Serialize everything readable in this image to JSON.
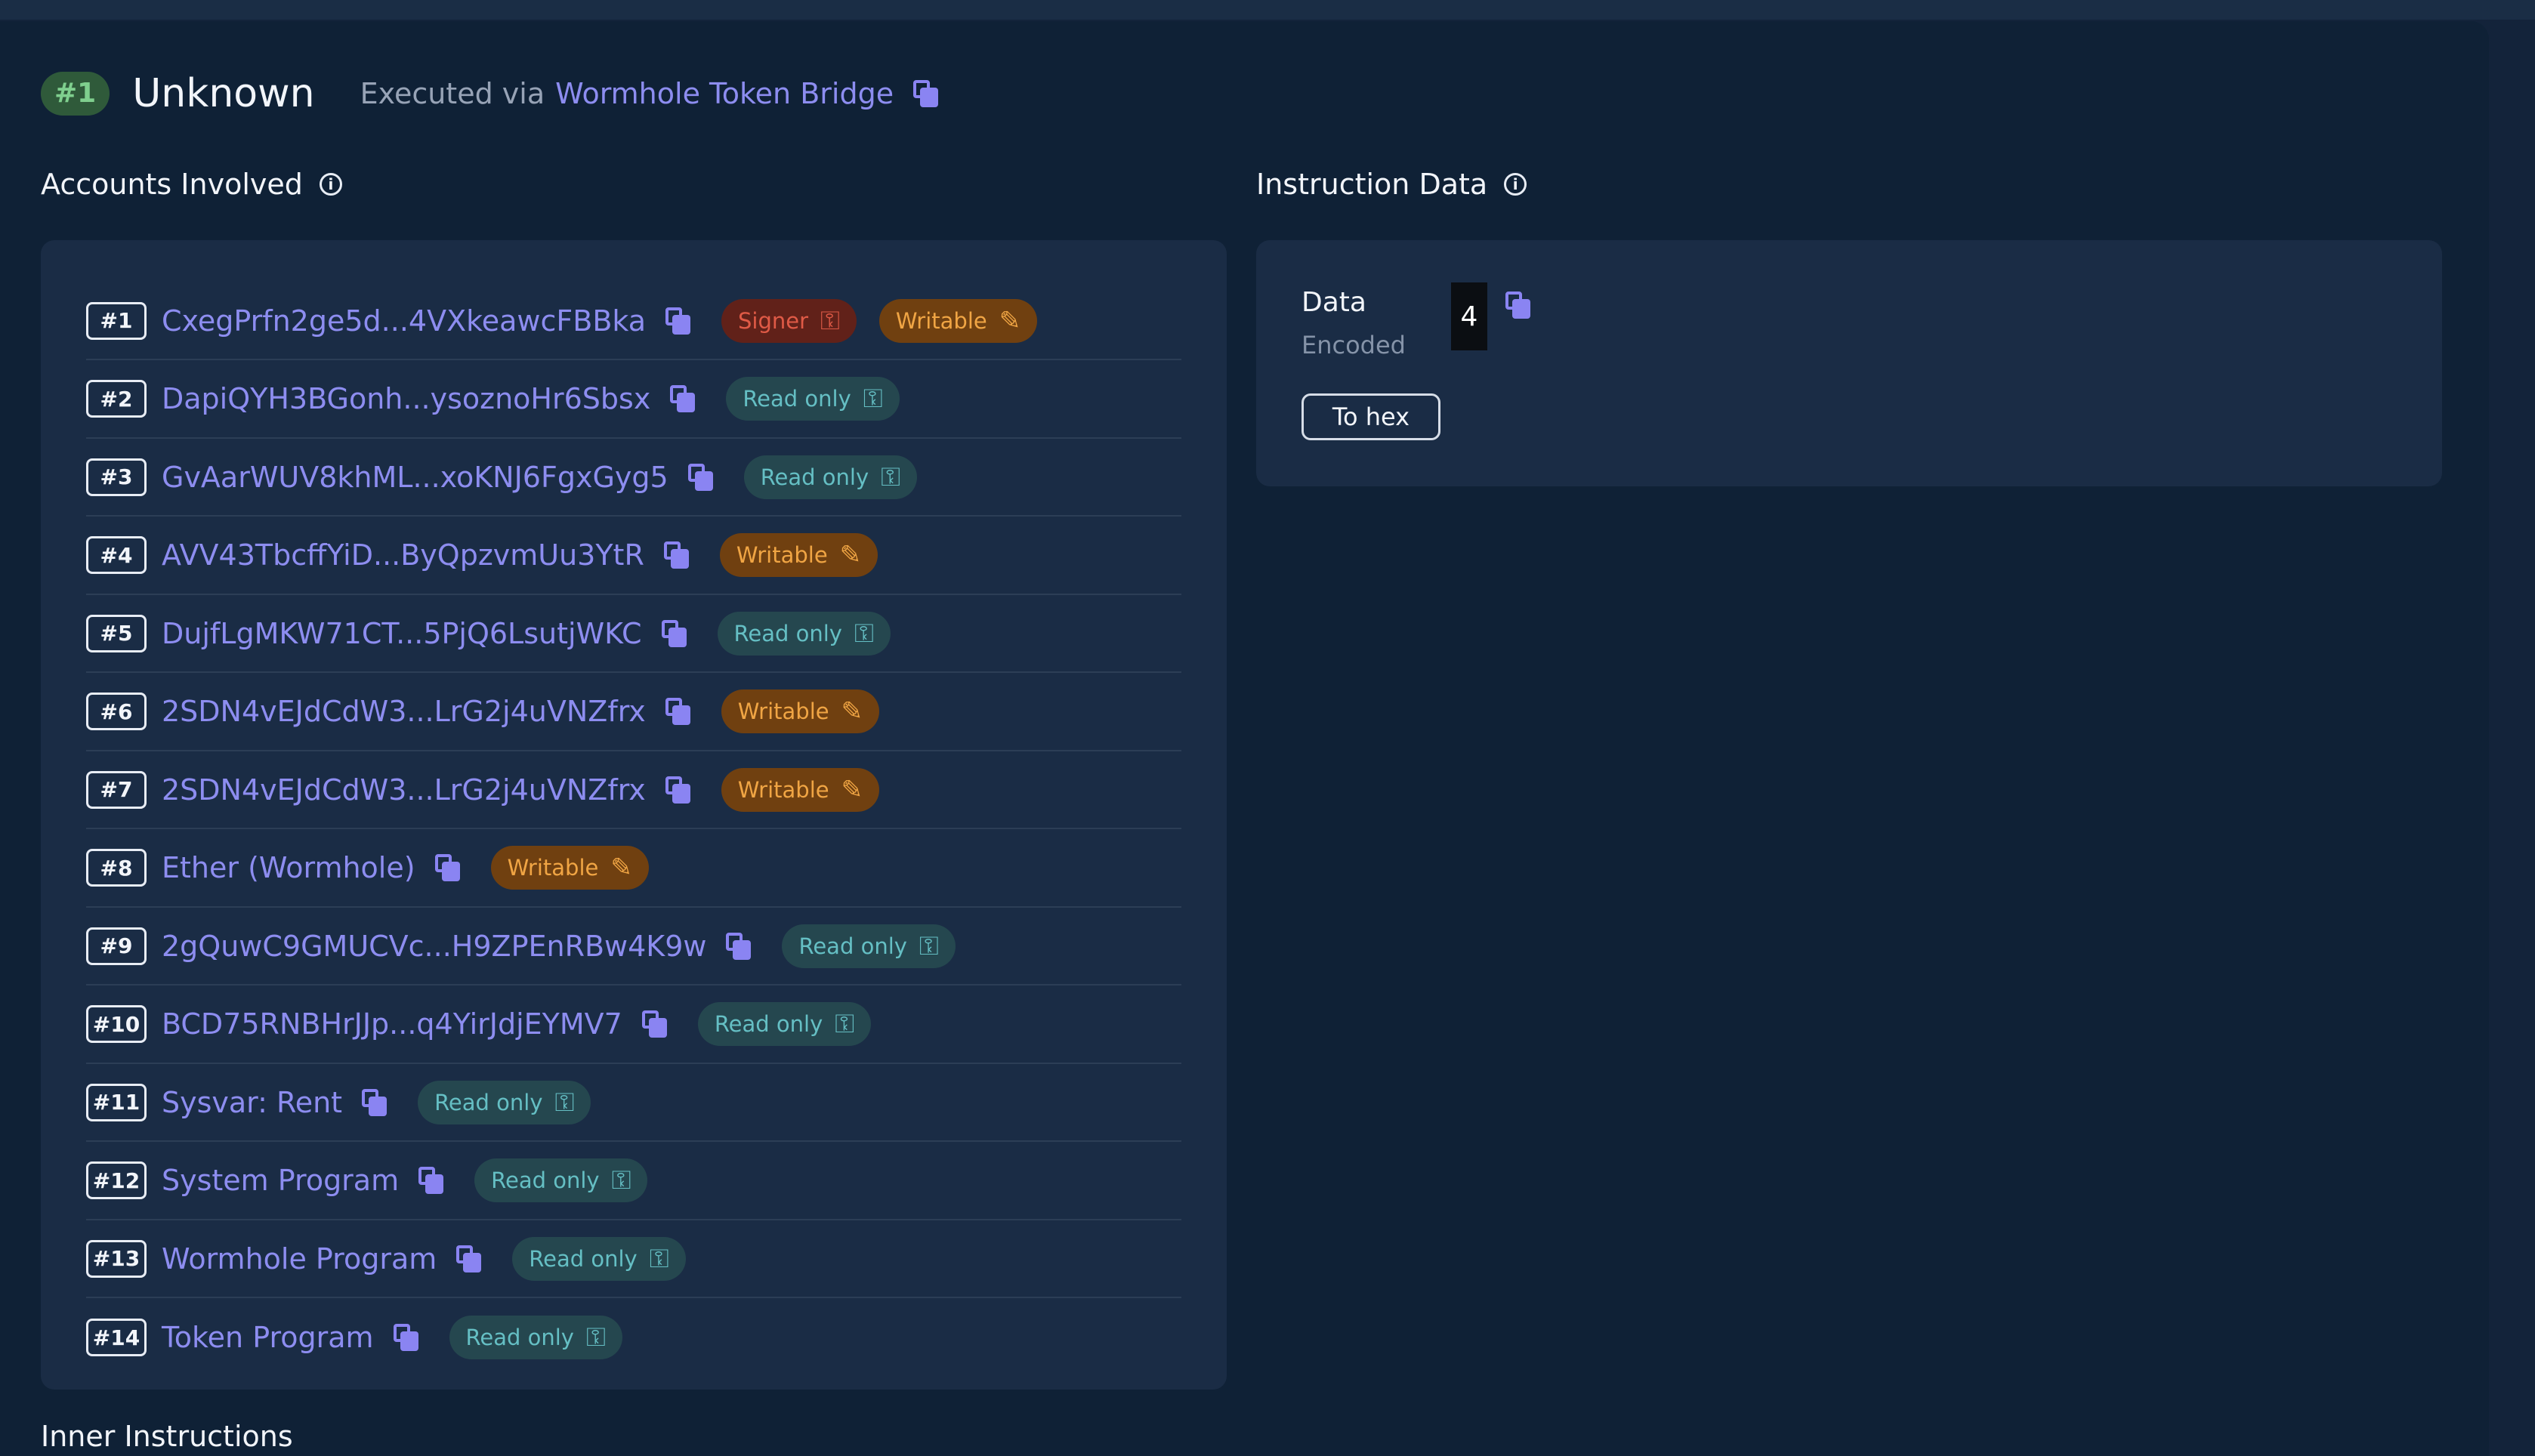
{
  "instruction": {
    "index": "#1",
    "title": "Unknown",
    "executed_via_label": "Executed via",
    "program_link": "Wormhole Token Bridge"
  },
  "accounts": {
    "title": "Accounts Involved",
    "rows": [
      {
        "index": "#1",
        "address": "CxegPrfn2ge5d...4VXkeawcFBBka",
        "badges": [
          {
            "kind": "sg",
            "label": "Signer",
            "icon": "key-icon"
          },
          {
            "kind": "wr",
            "label": "Writable",
            "icon": "pencil-icon"
          }
        ]
      },
      {
        "index": "#2",
        "address": "DapiQYH3BGonh...ysoznoHr6Sbsx",
        "badges": [
          {
            "kind": "ro",
            "label": "Read only",
            "icon": "key-icon"
          }
        ]
      },
      {
        "index": "#3",
        "address": "GvAarWUV8khML...xoKNJ6FgxGyg5",
        "badges": [
          {
            "kind": "ro",
            "label": "Read only",
            "icon": "key-icon"
          }
        ]
      },
      {
        "index": "#4",
        "address": "AVV43TbcffYiD...ByQpzvmUu3YtR",
        "badges": [
          {
            "kind": "wr",
            "label": "Writable",
            "icon": "pencil-icon"
          }
        ]
      },
      {
        "index": "#5",
        "address": "DujfLgMKW71CT...5PjQ6LsutjWKC",
        "badges": [
          {
            "kind": "ro",
            "label": "Read only",
            "icon": "key-icon"
          }
        ]
      },
      {
        "index": "#6",
        "address": "2SDN4vEJdCdW3...LrG2j4uVNZfrx",
        "badges": [
          {
            "kind": "wr",
            "label": "Writable",
            "icon": "pencil-icon"
          }
        ]
      },
      {
        "index": "#7",
        "address": "2SDN4vEJdCdW3...LrG2j4uVNZfrx",
        "badges": [
          {
            "kind": "wr",
            "label": "Writable",
            "icon": "pencil-icon"
          }
        ]
      },
      {
        "index": "#8",
        "address": "Ether (Wormhole)",
        "badges": [
          {
            "kind": "wr",
            "label": "Writable",
            "icon": "pencil-icon"
          }
        ]
      },
      {
        "index": "#9",
        "address": "2gQuwC9GMUCVc...H9ZPEnRBw4K9w",
        "badges": [
          {
            "kind": "ro",
            "label": "Read only",
            "icon": "key-icon"
          }
        ]
      },
      {
        "index": "#10",
        "address": "BCD75RNBHrJJp...q4YirJdjEYMV7",
        "badges": [
          {
            "kind": "ro",
            "label": "Read only",
            "icon": "key-icon"
          }
        ]
      },
      {
        "index": "#11",
        "address": "Sysvar: Rent",
        "badges": [
          {
            "kind": "ro",
            "label": "Read only",
            "icon": "key-icon"
          }
        ]
      },
      {
        "index": "#12",
        "address": "System Program",
        "badges": [
          {
            "kind": "ro",
            "label": "Read only",
            "icon": "key-icon"
          }
        ]
      },
      {
        "index": "#13",
        "address": "Wormhole Program",
        "badges": [
          {
            "kind": "ro",
            "label": "Read only",
            "icon": "key-icon"
          }
        ]
      },
      {
        "index": "#14",
        "address": "Token Program",
        "badges": [
          {
            "kind": "ro",
            "label": "Read only",
            "icon": "key-icon"
          }
        ]
      }
    ]
  },
  "instruction_data": {
    "title": "Instruction Data",
    "data_label": "Data",
    "encoding": "Encoded",
    "value": "4",
    "to_hex_button": "To hex"
  },
  "inner_instructions": {
    "title": "Inner Instructions"
  },
  "colors": {
    "link": "#8d8df0",
    "read_only": "#65bfc4",
    "writable": "#f0a544",
    "signer": "#df5a46",
    "index_badge": "#7fcf8e"
  }
}
